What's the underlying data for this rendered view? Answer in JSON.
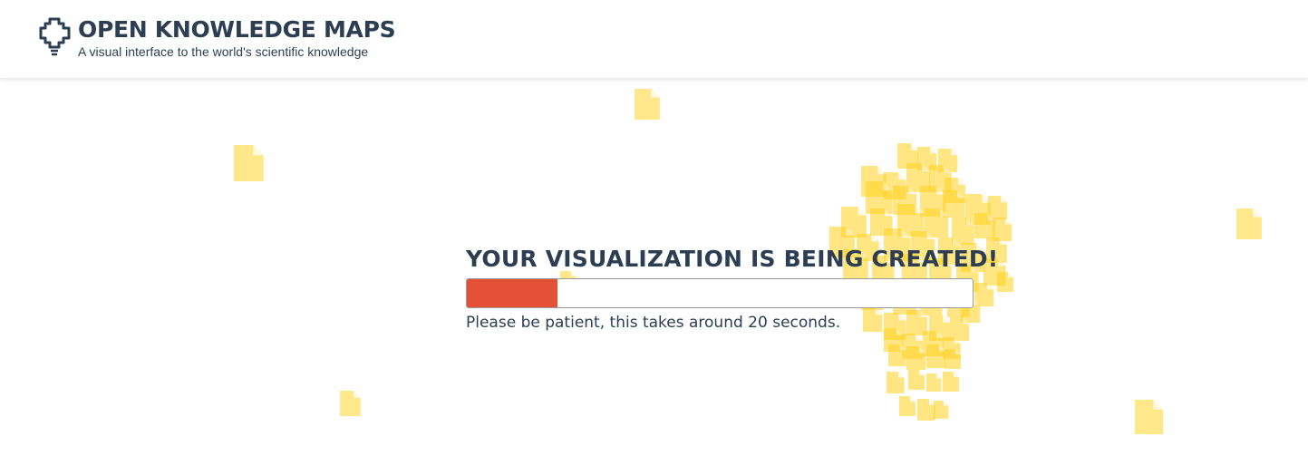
{
  "header": {
    "title": "OPEN KNOWLEDGE MAPS",
    "subtitle": "A visual interface to the world's scientific knowledge",
    "logo_icon": "brain-bulb-icon"
  },
  "main": {
    "heading": "YOUR VISUALIZATION IS BEING CREATED!",
    "progress": 0.18,
    "progress_color": "#e55137",
    "note": "Please be patient, this takes around 20 seconds."
  },
  "colors": {
    "text": "#2d3e52",
    "paper": "#ffe680",
    "paper_dense": "#ffd21f"
  },
  "background": {
    "icon": "paper-document-icon"
  }
}
